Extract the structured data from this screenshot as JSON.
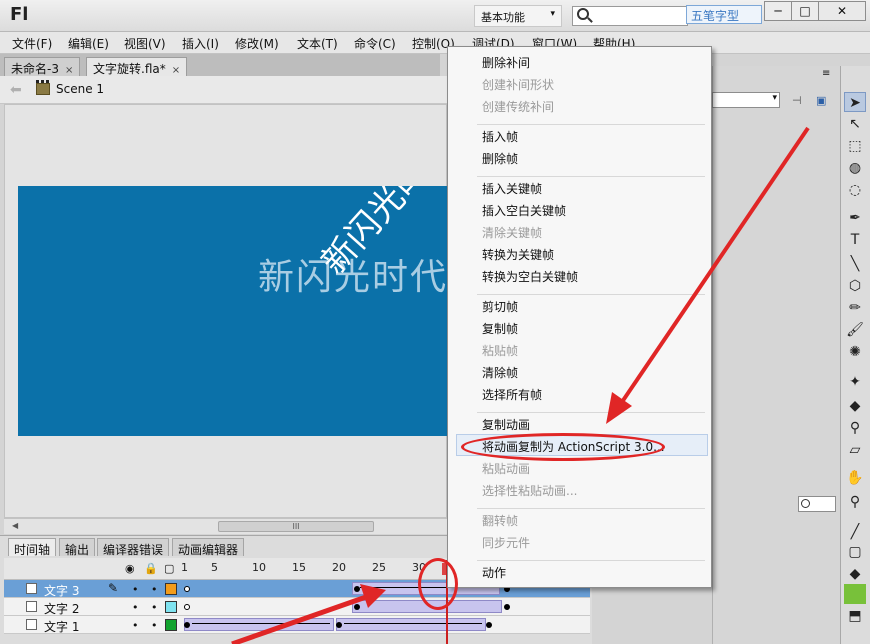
{
  "app": {
    "logo": "Fl",
    "workspace": "基本功能",
    "watermark": "五笔字型",
    "window_controls": [
      "─",
      "□",
      "✕"
    ]
  },
  "menubar": [
    "文件(F)",
    "编辑(E)",
    "视图(V)",
    "插入(I)",
    "修改(M)",
    "文本(T)",
    "命令(C)",
    "控制(O)",
    "调试(D)",
    "窗口(W)",
    "帮助(H)"
  ],
  "tabs": [
    {
      "label": "未命名-3",
      "close": "×"
    },
    {
      "label": "文字旋转.fla*",
      "close": "×"
    }
  ],
  "editbar": {
    "scene": "Scene 1"
  },
  "stage": {
    "background_color": "#0b71a9",
    "text_horizontal": "新闪光时代",
    "text_rotated": "新闪光时代"
  },
  "hscroll_thumb": "III",
  "timeline": {
    "tabs": [
      "时间轴",
      "输出",
      "编译器错误",
      "动画编辑器"
    ],
    "frame_numbers": [
      "1",
      "5",
      "10",
      "15",
      "20",
      "25",
      "30"
    ],
    "current_frame": 30,
    "layers": [
      {
        "name": "文字 3",
        "color": "#f39c1a",
        "selected": true
      },
      {
        "name": "文字 2",
        "color": "#7fe3f0",
        "selected": false
      },
      {
        "name": "文字 1",
        "color": "#12a32e",
        "selected": false
      }
    ]
  },
  "context_menu": {
    "items": [
      {
        "label": "删除补间",
        "enabled": true
      },
      {
        "label": "创建补间形状",
        "enabled": false
      },
      {
        "label": "创建传统补间",
        "enabled": false
      },
      {
        "sep": true
      },
      {
        "label": "插入帧",
        "enabled": true
      },
      {
        "label": "删除帧",
        "enabled": true
      },
      {
        "sep": true
      },
      {
        "label": "插入关键帧",
        "enabled": true
      },
      {
        "label": "插入空白关键帧",
        "enabled": true
      },
      {
        "label": "清除关键帧",
        "enabled": false
      },
      {
        "label": "转换为关键帧",
        "enabled": true
      },
      {
        "label": "转换为空白关键帧",
        "enabled": true
      },
      {
        "sep": true
      },
      {
        "label": "剪切帧",
        "enabled": true
      },
      {
        "label": "复制帧",
        "enabled": true
      },
      {
        "label": "粘贴帧",
        "enabled": false
      },
      {
        "label": "清除帧",
        "enabled": true
      },
      {
        "label": "选择所有帧",
        "enabled": true
      },
      {
        "sep": true
      },
      {
        "label": "复制动画",
        "enabled": true
      },
      {
        "label": "将动画复制为 ActionScript 3.0...",
        "enabled": true,
        "highlighted": true
      },
      {
        "label": "粘贴动画",
        "enabled": false
      },
      {
        "label": "选择性粘贴动画...",
        "enabled": false
      },
      {
        "sep": true
      },
      {
        "label": "翻转帧",
        "enabled": false
      },
      {
        "label": "同步元件",
        "enabled": false
      },
      {
        "sep": true
      },
      {
        "label": "动作",
        "enabled": true
      }
    ]
  },
  "tools": [
    "selection-icon",
    "subselection-icon",
    "free-transform-icon",
    "3d-rotation-icon",
    "lasso-icon",
    "pen-icon",
    "text-icon",
    "line-icon",
    "rectangle-icon",
    "pencil-icon",
    "brush-icon",
    "deco-icon",
    "bone-icon",
    "paint-bucket-icon",
    "eyedropper-icon",
    "eraser-icon",
    "hand-icon",
    "zoom-icon",
    "stroke-color-icon",
    "fill-color-icon"
  ],
  "tool_glyphs": {
    "text-icon": "T"
  },
  "annotation_color": "#e02626"
}
